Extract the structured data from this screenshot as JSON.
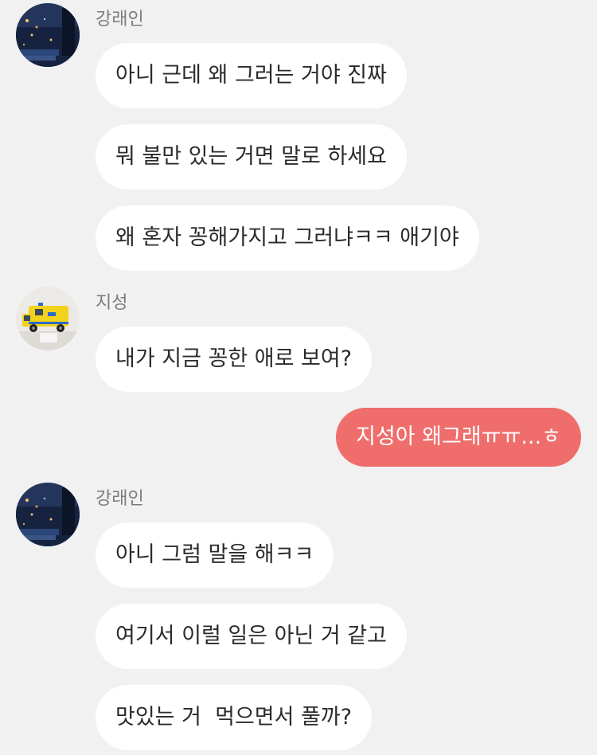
{
  "colors": {
    "background": "#f1f1f1",
    "incoming_bubble": "#ffffff",
    "outgoing_bubble": "#ef6e6c",
    "sender_name": "#7b7b7b"
  },
  "groups": [
    {
      "sender": "강래인",
      "avatar": "night-city-photo-avatar",
      "messages": [
        "아니 근데 왜 그러는 거야 진짜",
        "뭐 불만 있는 거면 말로 하세요",
        "왜 혼자 꽁해가지고 그러냐ㅋㅋ 애기야"
      ]
    },
    {
      "sender": "지성",
      "avatar": "toy-ambulance-photo-avatar",
      "messages": [
        "내가 지금 꽁한 애로 보여?"
      ]
    },
    {
      "sender": "me",
      "messages": [
        "지성아 왜그래ㅠㅠ...ㅎ"
      ]
    },
    {
      "sender": "강래인",
      "avatar": "night-city-photo-avatar",
      "messages": [
        "아니 그럼 말을 해ㅋㅋ",
        "여기서 이럴 일은 아닌 거 같고",
        "맛있는 거  먹으면서 풀까?"
      ]
    }
  ]
}
